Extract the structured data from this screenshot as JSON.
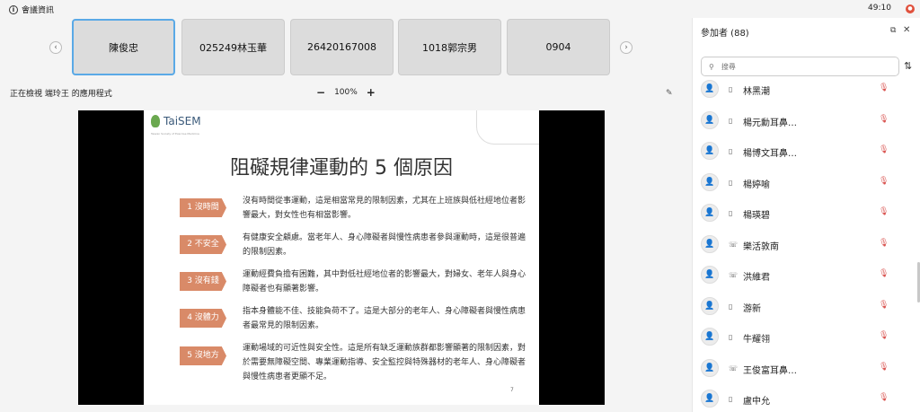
{
  "top": {
    "info_label": "會議資訊",
    "timer": "49:10"
  },
  "tiles": [
    "陳俊忠",
    "025249林玉華",
    "26420167008",
    "1018郭宗男",
    "0904"
  ],
  "viewing": {
    "text": "正在檢視 端玲王 的應用程式",
    "zoom": "100%",
    "zoom_out": "−",
    "zoom_in": "+"
  },
  "slide": {
    "logo": "TaiSEM",
    "logo_sub": "Taiwan Society of Exercise Medicine",
    "title": "阻礙規律運動的 5 個原因",
    "page": "7",
    "items": [
      {
        "tag": "1 沒時間",
        "text": "沒有時間從事運動，這是相當常見的限制因素，尤其在上班族與低社經地位者影響最大，對女性也有相當影響。"
      },
      {
        "tag": "2 不安全",
        "text": "有健康安全顧慮。當老年人、身心障礙者與慢性病患者參與運動時，這是很普遍的限制因素。"
      },
      {
        "tag": "3 沒有錢",
        "text": "運動經費負擔有困難，其中對低社經地位者的影響最大，對婦女、老年人與身心障礙者也有顯著影響。"
      },
      {
        "tag": "4 沒體力",
        "text": "指本身體能不佳、技能負荷不了。這是大部分的老年人、身心障礙者與慢性病患者最常見的限制因素。"
      },
      {
        "tag": "5 沒地方",
        "text": "運動場域的可近性與安全性。這是所有缺乏運動族群都影響顯著的限制因素，對於需要無障礙空間、專業運動指導、安全監控與特殊器材的老年人、身心障礙者與慢性病患者更顯不足。"
      }
    ]
  },
  "panel": {
    "title": "參加者 (88)",
    "search_placeholder": "搜尋",
    "participants": [
      {
        "name": "林黑潮",
        "device": "phone"
      },
      {
        "name": "楊元勳耳鼻…",
        "device": "phone"
      },
      {
        "name": "楊博文耳鼻…",
        "device": "phone"
      },
      {
        "name": "楊婷喻",
        "device": "phone"
      },
      {
        "name": "楊瑛碧",
        "device": "phone"
      },
      {
        "name": "樂活敦南",
        "device": "call"
      },
      {
        "name": "洪維君",
        "device": "call"
      },
      {
        "name": "游新",
        "device": "phone"
      },
      {
        "name": "牛耀翎",
        "device": "phone"
      },
      {
        "name": "王俊富耳鼻…",
        "device": "call"
      },
      {
        "name": "盧中允",
        "device": "phone"
      }
    ]
  }
}
